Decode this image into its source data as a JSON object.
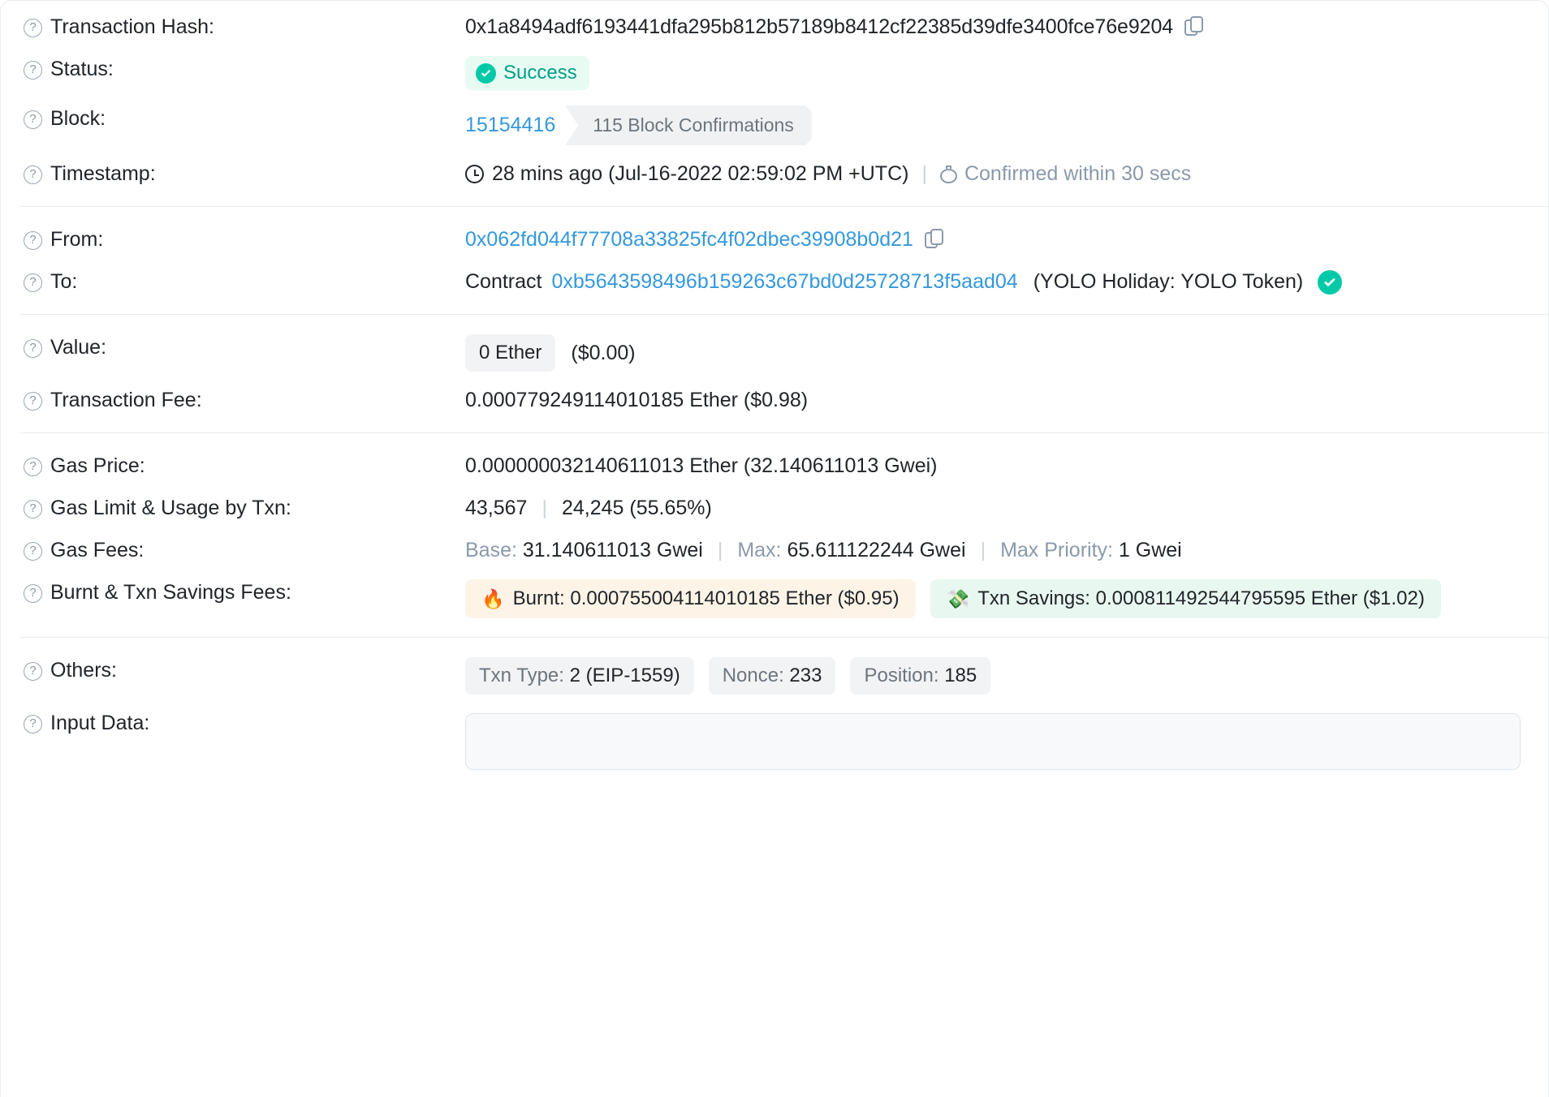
{
  "rows": {
    "transaction_hash": {
      "label": "Transaction Hash:",
      "value": "0x1a8494adf6193441dfa295b812b57189b8412cf22385d39dfe3400fce76e9204"
    },
    "status": {
      "label": "Status:",
      "value": "Success"
    },
    "block": {
      "label": "Block:",
      "number": "15154416",
      "confirmations": "115 Block Confirmations"
    },
    "timestamp": {
      "label": "Timestamp:",
      "value": "28 mins ago (Jul-16-2022 02:59:02 PM +UTC)",
      "separator": "|",
      "confirmed_within": "Confirmed within 30 secs"
    },
    "from": {
      "label": "From:",
      "address": "0x062fd044f77708a33825fc4f02dbec39908b0d21"
    },
    "to": {
      "label": "To:",
      "prefix": "Contract",
      "address": "0xb5643598496b159263c67bd0d25728713f5aad04",
      "token_name": "(YOLO Holiday: YOLO Token)"
    },
    "value": {
      "label": "Value:",
      "ether": "0 Ether",
      "usd": "($0.00)"
    },
    "transaction_fee": {
      "label": "Transaction Fee:",
      "value": "0.000779249114010185 Ether ($0.98)"
    },
    "gas_price": {
      "label": "Gas Price:",
      "value": "0.000000032140611013 Ether (32.140611013 Gwei)"
    },
    "gas_limit_usage": {
      "label": "Gas Limit & Usage by Txn:",
      "limit": "43,567",
      "separator": "|",
      "usage": "24,245 (55.65%)"
    },
    "gas_fees": {
      "label": "Gas Fees:",
      "base_key": "Base:",
      "base_value": "31.140611013 Gwei",
      "sep1": "|",
      "max_key": "Max:",
      "max_value": "65.611122244 Gwei",
      "sep2": "|",
      "priority_key": "Max Priority:",
      "priority_value": "1 Gwei"
    },
    "burnt_savings": {
      "label": "Burnt & Txn Savings Fees:",
      "burnt_emoji": "🔥",
      "burnt": "Burnt: 0.000755004114010185 Ether ($0.95)",
      "savings_emoji": "💸",
      "savings": "Txn Savings: 0.000811492544795595 Ether ($1.02)"
    },
    "others": {
      "label": "Others:",
      "chips": [
        {
          "key": "Txn Type:",
          "value": "2 (EIP-1559)"
        },
        {
          "key": "Nonce:",
          "value": "233"
        },
        {
          "key": "Position:",
          "value": "185"
        }
      ]
    },
    "input_data": {
      "label": "Input Data:"
    }
  },
  "icons": {
    "help": "?",
    "copy": "copy-icon",
    "clock": "clock-icon",
    "stopwatch": "stopwatch-icon",
    "check": "check-icon",
    "verified": "verified-icon"
  },
  "colors": {
    "link": "#3498db",
    "success": "#00c9a7",
    "success_bg": "#e8fbf3",
    "muted": "#8a99ab",
    "chip_bg": "#f2f3f5",
    "burnt_bg": "#fdf3e7",
    "savings_bg": "#e9f7f1",
    "text": "#212529",
    "border": "#e9ecef"
  }
}
